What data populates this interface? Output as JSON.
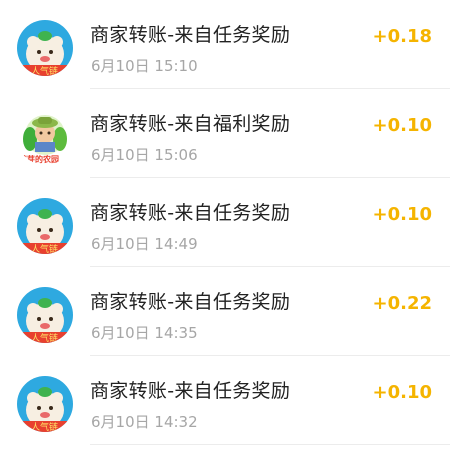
{
  "transactions": [
    {
      "title": "商家转账-来自任务奖励",
      "time": "6月10日 15:10",
      "amount": "+0.18",
      "avatar": "sheep-avatar-icon",
      "avatar_text": "人气链"
    },
    {
      "title": "商家转账-来自福利奖励",
      "time": "6月10日 15:06",
      "amount": "+0.10",
      "avatar": "farm-avatar-icon",
      "avatar_text": "芽芽的农园"
    },
    {
      "title": "商家转账-来自任务奖励",
      "time": "6月10日 14:49",
      "amount": "+0.10",
      "avatar": "sheep-avatar-icon",
      "avatar_text": "人气链"
    },
    {
      "title": "商家转账-来自任务奖励",
      "time": "6月10日 14:35",
      "amount": "+0.22",
      "avatar": "sheep-avatar-icon",
      "avatar_text": "人气链"
    },
    {
      "title": "商家转账-来自任务奖励",
      "time": "6月10日 14:32",
      "amount": "+0.10",
      "avatar": "sheep-avatar-icon",
      "avatar_text": "人气链"
    }
  ],
  "colors": {
    "amount": "#f5b400",
    "title": "#222222",
    "time": "#a6a6a6",
    "avatar_bg": "#2ea9e0"
  }
}
